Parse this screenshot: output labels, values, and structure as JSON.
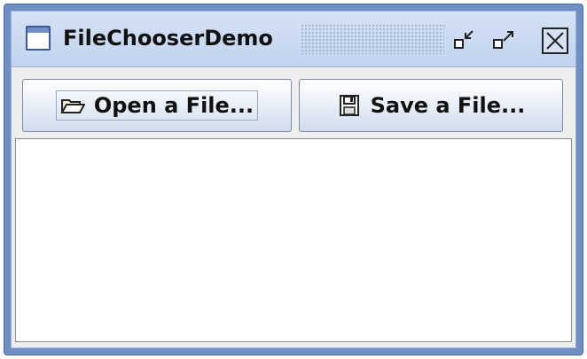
{
  "window": {
    "title": "FileChooserDemo",
    "controls": {
      "minimize_icon": "minimize-icon",
      "maximize_icon": "maximize-icon",
      "close_icon": "close-icon"
    }
  },
  "toolbar": {
    "open_button": {
      "label": "Open a File...",
      "icon": "open-folder-icon"
    },
    "save_button": {
      "label": "Save a File...",
      "icon": "floppy-disk-icon"
    }
  },
  "log": {
    "text": ""
  },
  "colors": {
    "frame": "#6f8fc4",
    "titlebar": "#c1d3ee",
    "content_bg": "#ffffff"
  }
}
